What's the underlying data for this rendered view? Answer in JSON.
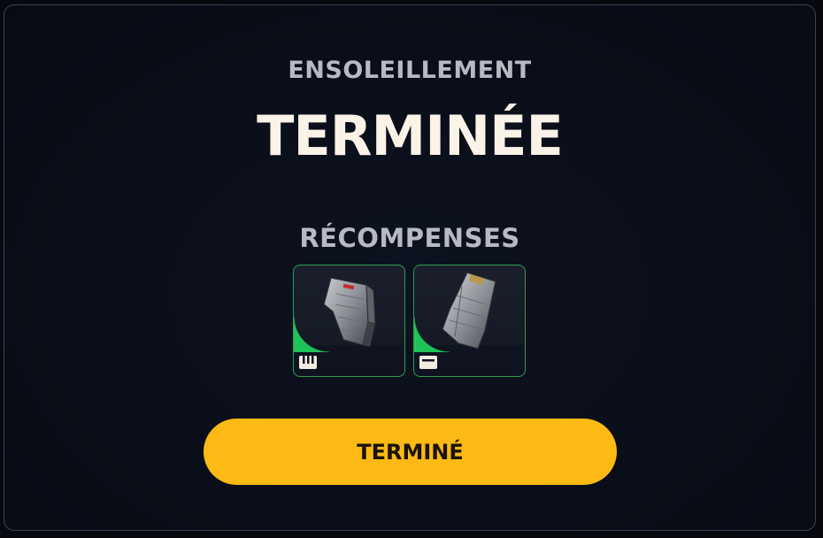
{
  "modal": {
    "subtitle": "ENSOLEILLEMENT",
    "title": "TERMINÉE"
  },
  "rewards": {
    "heading": "RÉCOMPENSES",
    "items": [
      {
        "item_icon": "magazine-icon",
        "slot_icon": "inventory-slot-icon"
      },
      {
        "item_icon": "magazine-icon",
        "slot_icon": "storage-slot-icon"
      }
    ]
  },
  "actions": {
    "done_label": "TERMINÉ"
  },
  "colors": {
    "accent": "#fdb914",
    "rarity_green": "#20c35a",
    "text_primary": "#fcf3e8",
    "text_secondary": "#b7bac3",
    "background": "#0a0e18"
  }
}
